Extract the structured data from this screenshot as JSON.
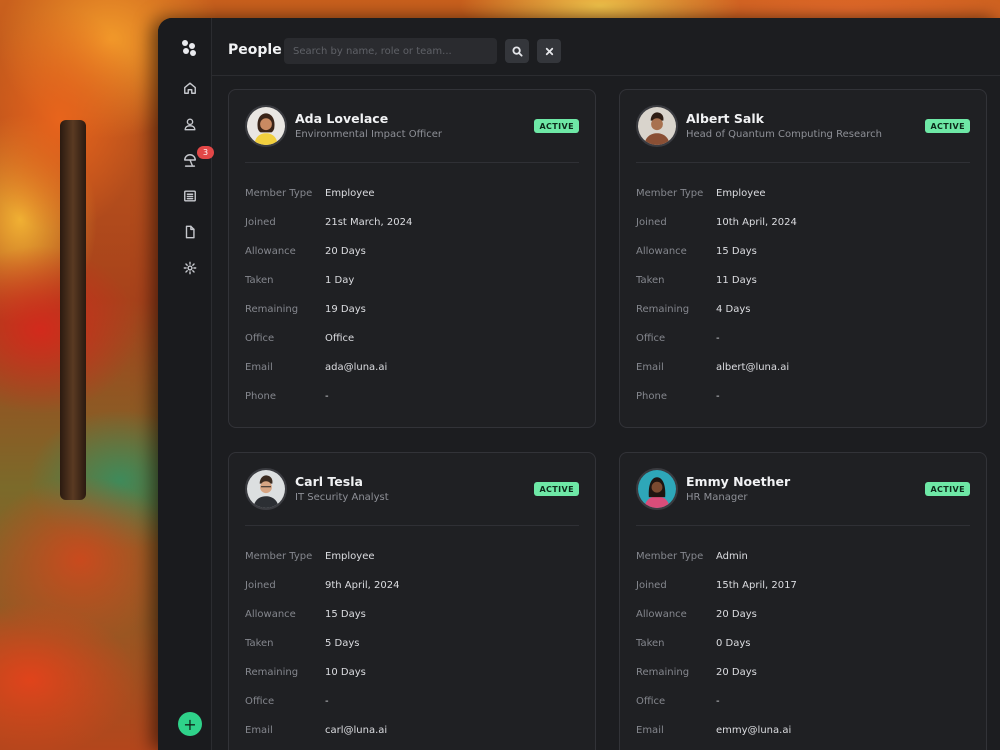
{
  "header": {
    "title": "People",
    "search_placeholder": "Search by name, role or team..."
  },
  "sidebar": {
    "items": [
      {
        "icon": "home-icon"
      },
      {
        "icon": "user-icon"
      },
      {
        "icon": "beach-umbrella-icon",
        "badge": "3"
      },
      {
        "icon": "list-icon"
      },
      {
        "icon": "document-icon"
      },
      {
        "icon": "gear-icon"
      }
    ],
    "add_label": "+"
  },
  "field_labels": {
    "member_type": "Member Type",
    "joined": "Joined",
    "allowance": "Allowance",
    "taken": "Taken",
    "remaining": "Remaining",
    "office": "Office",
    "email": "Email",
    "phone": "Phone"
  },
  "colors": {
    "accent": "#2fd28a",
    "status_active": "#6ee8a6",
    "badge": "#e24747",
    "window_bg": "#1c1d20"
  },
  "people": [
    {
      "name": "Ada Lovelace",
      "role": "Environmental Impact Officer",
      "status": "ACTIVE",
      "member_type": "Employee",
      "joined": "21st March, 2024",
      "allowance": "20 Days",
      "taken": "1 Day",
      "remaining": "19 Days",
      "office": "Office",
      "email": "ada@luna.ai",
      "phone": "-"
    },
    {
      "name": "Albert Salk",
      "role": "Head of Quantum Computing Research",
      "status": "ACTIVE",
      "member_type": "Employee",
      "joined": "10th April, 2024",
      "allowance": "15 Days",
      "taken": "11 Days",
      "remaining": "4 Days",
      "office": "-",
      "email": "albert@luna.ai",
      "phone": "-"
    },
    {
      "name": "Carl Tesla",
      "role": "IT Security Analyst",
      "status": "ACTIVE",
      "member_type": "Employee",
      "joined": "9th April, 2024",
      "allowance": "15 Days",
      "taken": "5 Days",
      "remaining": "10 Days",
      "office": "-",
      "email": "carl@luna.ai"
    },
    {
      "name": "Emmy Noether",
      "role": "HR Manager",
      "status": "ACTIVE",
      "member_type": "Admin",
      "joined": "15th April, 2017",
      "allowance": "20 Days",
      "taken": "0 Days",
      "remaining": "20 Days",
      "office": "-",
      "email": "emmy@luna.ai"
    }
  ]
}
